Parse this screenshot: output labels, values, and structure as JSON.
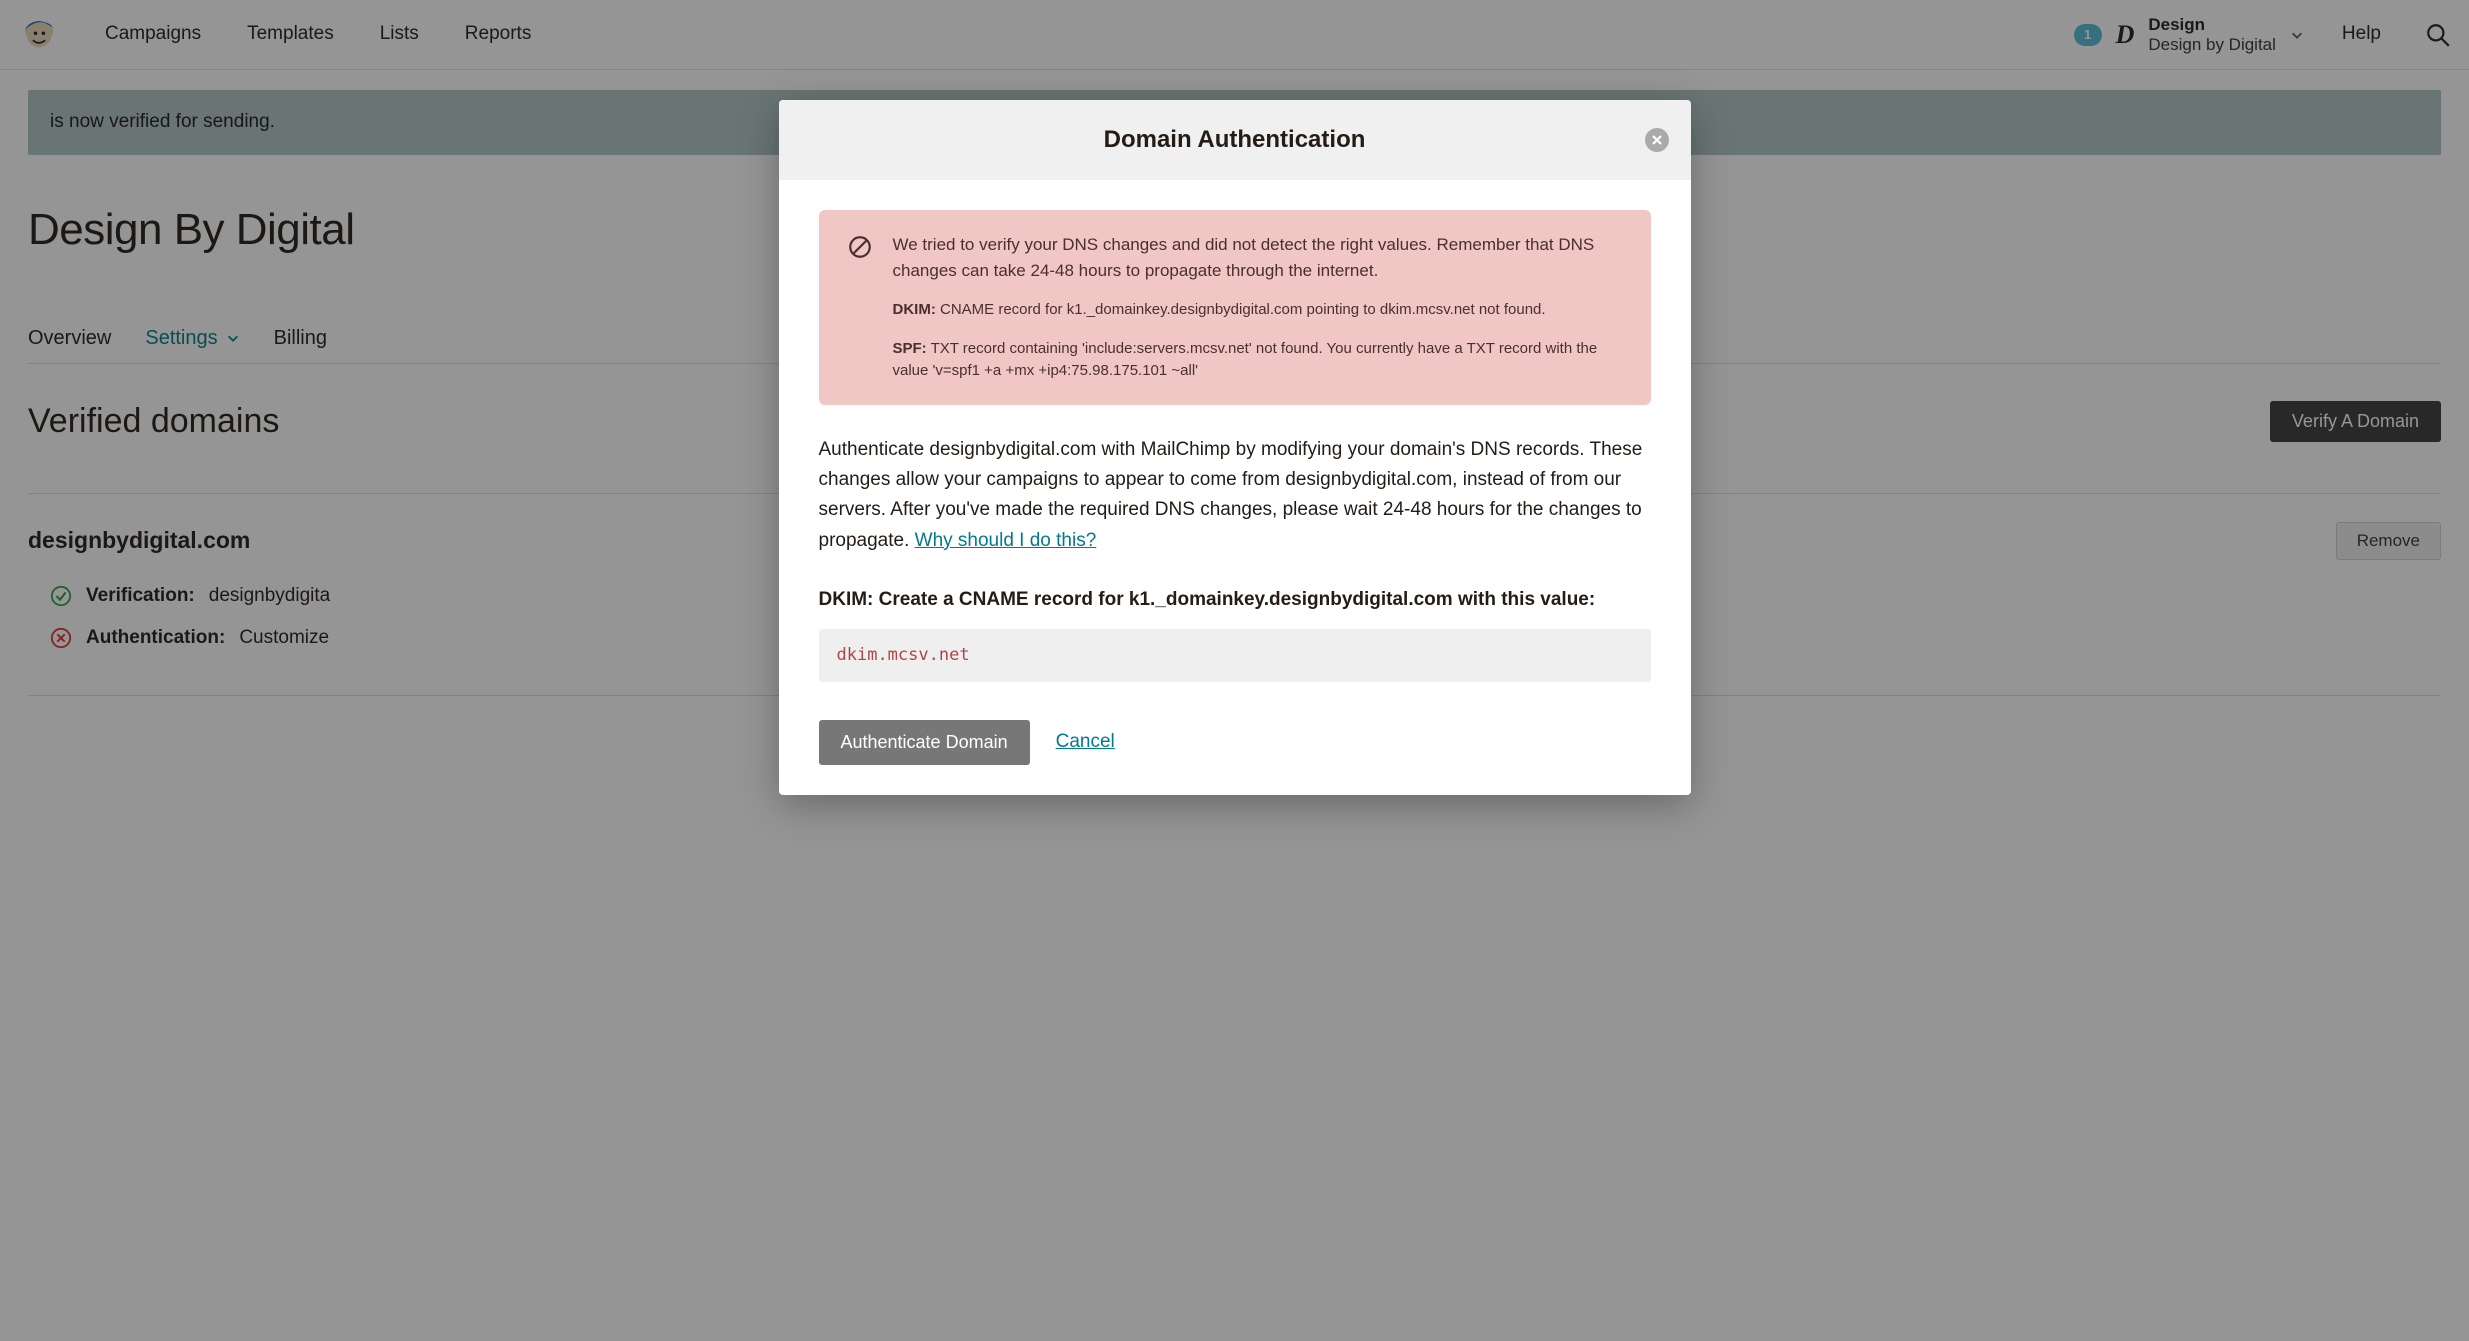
{
  "nav": {
    "items": [
      "Campaigns",
      "Templates",
      "Lists",
      "Reports"
    ],
    "badge": "1",
    "avatar_letter": "D",
    "account_line1": "Design",
    "account_line2": "Design by Digital",
    "help": "Help"
  },
  "alert": {
    "text": "is now verified for sending."
  },
  "page": {
    "title": "Design By Digital",
    "tabs": [
      "Overview",
      "Settings",
      "Billing"
    ],
    "active_tab_index": 1,
    "section_heading": "Verified domains",
    "verify_btn": "Verify A Domain"
  },
  "domain": {
    "name": "designbydigital.com",
    "remove_btn": "Remove",
    "verification_label": "Verification:",
    "verification_text": "designbydigita",
    "auth_label": "Authentication:",
    "auth_text": "Customize"
  },
  "modal": {
    "title": "Domain Authentication",
    "error_main": "We tried to verify your DNS changes and did not detect the right values. Remember that DNS changes can take 24-48 hours to propagate through the internet.",
    "dkim_label": "DKIM:",
    "dkim_text": "CNAME record for k1._domainkey.designbydigital.com pointing to dkim.mcsv.net not found.",
    "spf_label": "SPF:",
    "spf_text": "TXT record containing 'include:servers.mcsv.net' not found. You currently have a TXT record with the value 'v=spf1 +a +mx +ip4:75.98.175.101 ~all'",
    "body_para": "Authenticate designbydigital.com with MailChimp by modifying your domain's DNS records. These changes allow your campaigns to appear to come from designbydigital.com, instead of from our servers. After you've made the required DNS changes, please wait 24-48 hours for the changes to propagate. ",
    "why_link": "Why should I do this?",
    "dkim_heading": "DKIM: Create a CNAME record for k1._domainkey.designbydigital.com with this value:",
    "dkim_value": "dkim.mcsv.net",
    "auth_btn": "Authenticate Domain",
    "cancel": "Cancel"
  }
}
